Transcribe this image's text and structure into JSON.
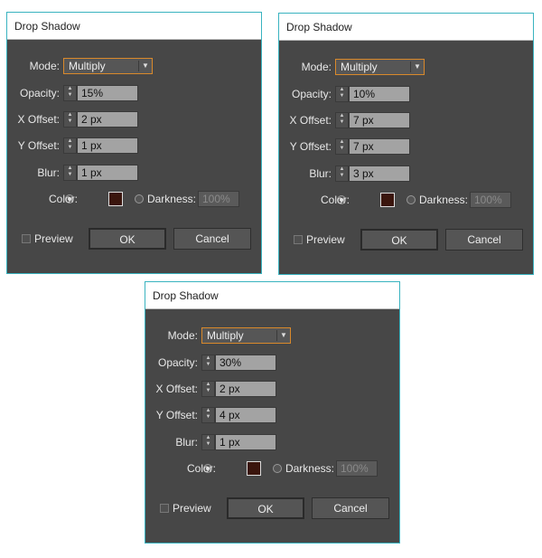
{
  "labels": {
    "mode": "Mode:",
    "opacity": "Opacity:",
    "x_offset": "X Offset:",
    "y_offset": "Y Offset:",
    "blur": "Blur:",
    "color": "Color:",
    "darkness": "Darkness:",
    "preview": "Preview",
    "ok": "OK",
    "cancel": "Cancel"
  },
  "colors": {
    "accent": "#d9892b",
    "border": "#39b3c0",
    "swatch": "#3a150d"
  },
  "dialogs": [
    {
      "title": "Drop Shadow",
      "mode": "Multiply",
      "opacity": "15%",
      "x_offset": "2 px",
      "y_offset": "1 px",
      "blur": "1 px",
      "darkness": "100%"
    },
    {
      "title": "Drop Shadow",
      "mode": "Multiply",
      "opacity": "10%",
      "x_offset": "7 px",
      "y_offset": "7 px",
      "blur": "3 px",
      "darkness": "100%"
    },
    {
      "title": "Drop Shadow",
      "mode": "Multiply",
      "opacity": "30%",
      "x_offset": "2 px",
      "y_offset": "4 px",
      "blur": "1 px",
      "darkness": "100%"
    }
  ]
}
